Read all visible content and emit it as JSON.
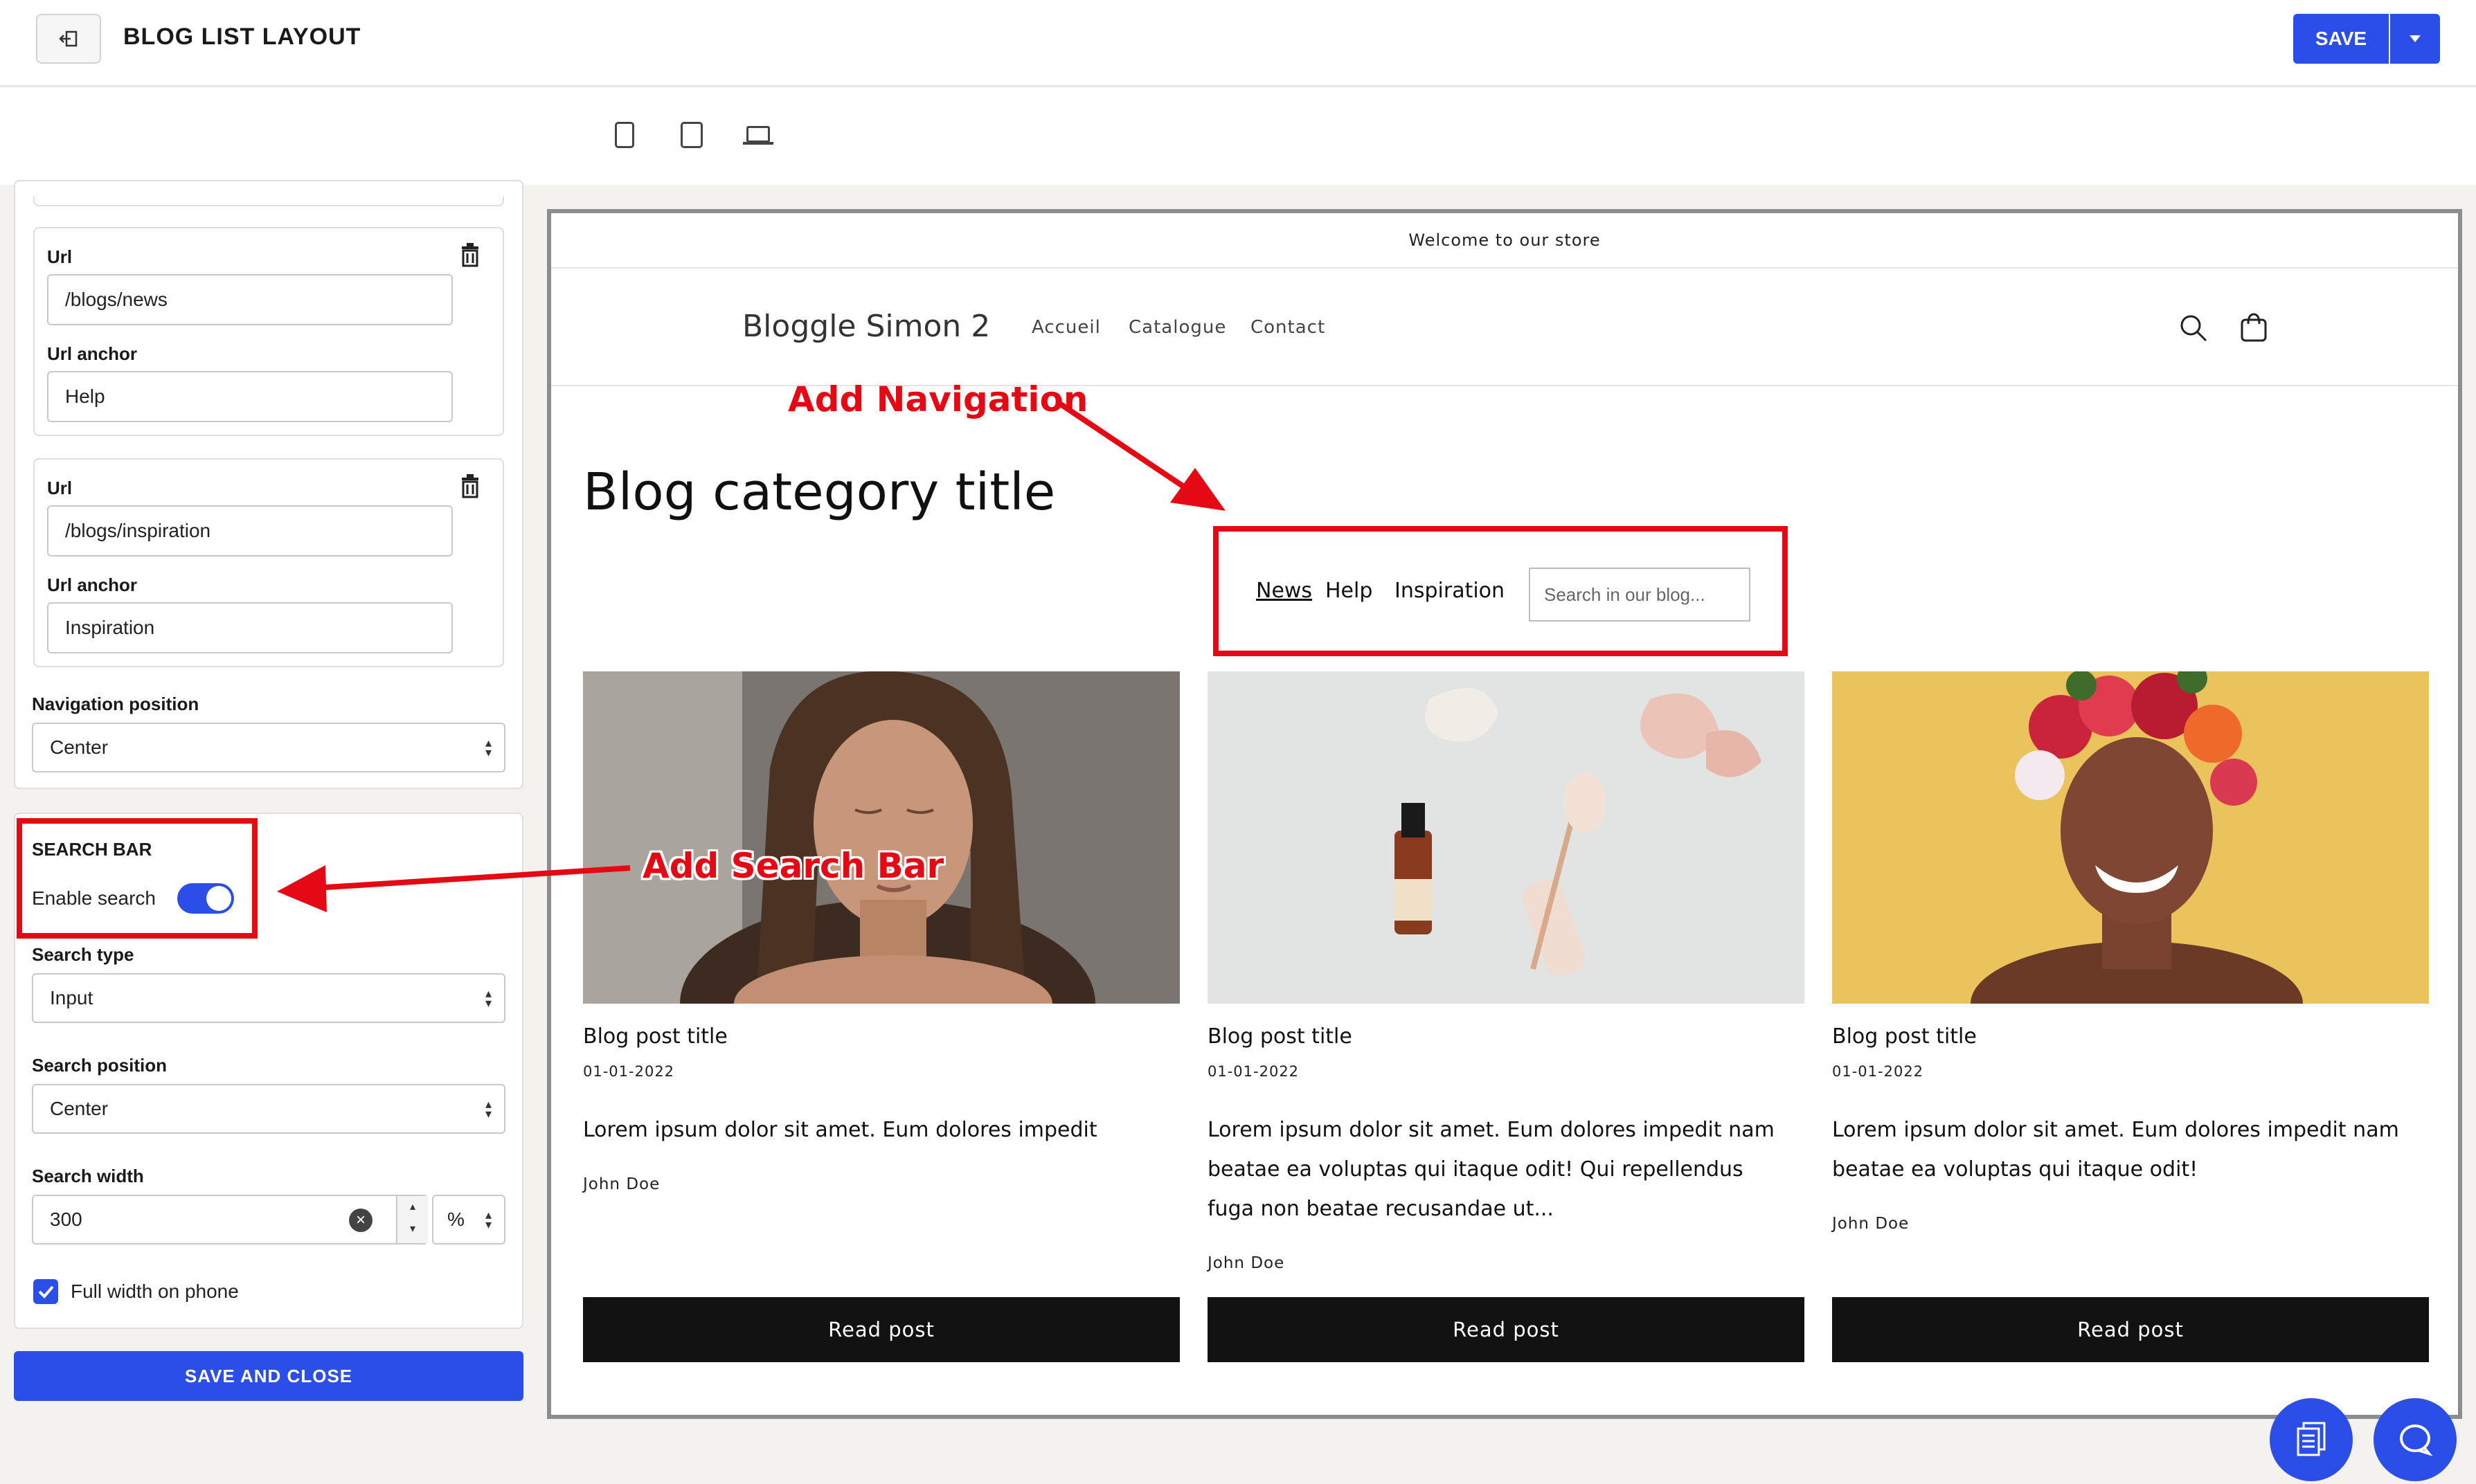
{
  "header": {
    "title": "BLOG LIST LAYOUT",
    "save_label": "SAVE"
  },
  "panel": {
    "links": [
      {
        "url_label": "Url",
        "url_value": "/blogs/news",
        "anchor_label": "Url anchor",
        "anchor_value": "Help"
      },
      {
        "url_label": "Url",
        "url_value": "/blogs/inspiration",
        "anchor_label": "Url anchor",
        "anchor_value": "Inspiration"
      }
    ],
    "nav_position_label": "Navigation position",
    "nav_position_value": "Center",
    "search_section_title": "SEARCH BAR",
    "enable_search_label": "Enable search",
    "enable_search": true,
    "search_type_label": "Search type",
    "search_type_value": "Input",
    "search_position_label": "Search position",
    "search_position_value": "Center",
    "search_width_label": "Search width",
    "search_width_value": "300",
    "search_width_unit": "%",
    "full_width_label": "Full width on phone",
    "full_width_checked": true,
    "save_close_label": "SAVE AND CLOSE"
  },
  "preview": {
    "announcement": "Welcome to our store",
    "brand": "Bloggle Simon 2",
    "menu": [
      "Accueil",
      "Catalogue",
      "Contact"
    ],
    "blog_title": "Blog category title",
    "blog_nav": [
      "News",
      "Help",
      "Inspiration"
    ],
    "search_placeholder": "Search in our blog...",
    "posts": [
      {
        "title": "Blog post title",
        "date": "01-01-2022",
        "excerpt": "Lorem ipsum dolor sit amet. Eum dolores impedit",
        "author": "John Doe",
        "button": "Read post"
      },
      {
        "title": "Blog post title",
        "date": "01-01-2022",
        "excerpt": "Lorem ipsum dolor sit amet. Eum dolores impedit nam beatae ea voluptas qui itaque odit! Qui repellendus fuga non beatae recusandae ut...",
        "author": "John Doe",
        "button": "Read post"
      },
      {
        "title": "Blog post title",
        "date": "01-01-2022",
        "excerpt": "Lorem ipsum dolor sit amet. Eum dolores impedit nam beatae ea voluptas qui itaque odit!",
        "author": "John Doe",
        "button": "Read post"
      }
    ]
  },
  "annotations": {
    "add_navigation": "Add Navigation",
    "add_search_bar": "Add Search Bar"
  },
  "colors": {
    "accent": "#2b4ee8",
    "annotation": "#e50914",
    "button_dark": "#121212"
  }
}
